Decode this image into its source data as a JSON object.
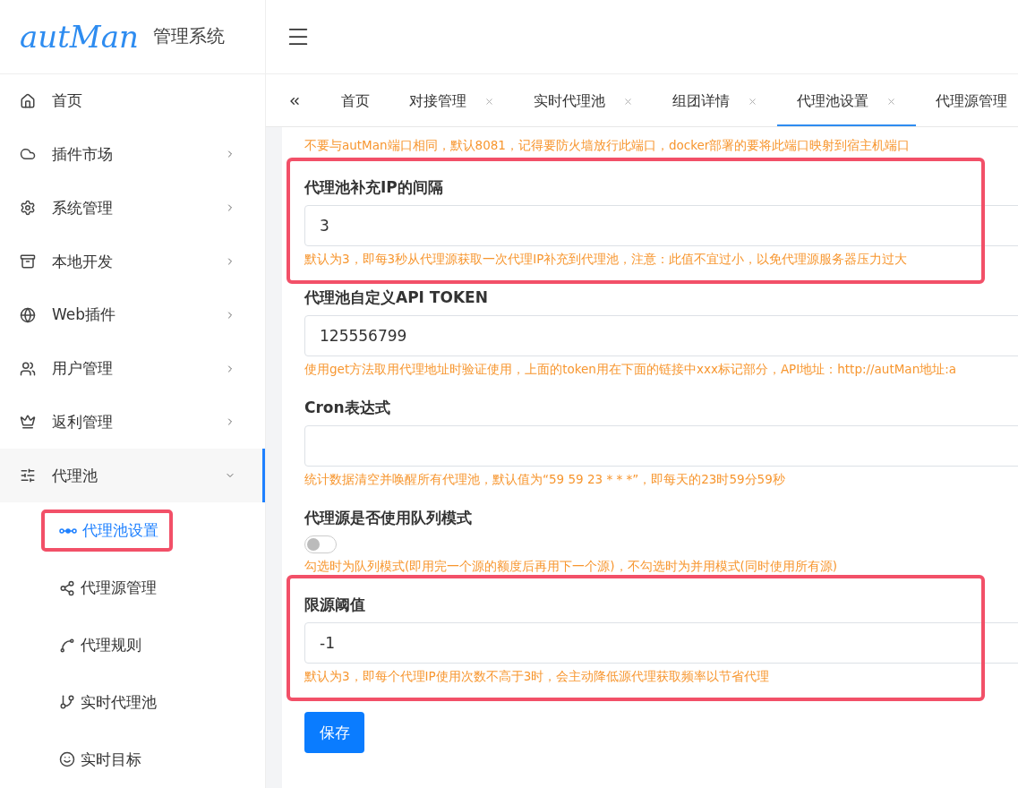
{
  "brand": {
    "logo": "autMan",
    "title": "管理系统"
  },
  "sidebar": {
    "items": [
      {
        "label": "首页",
        "has_submenu": false,
        "expanded": false
      },
      {
        "label": "插件市场",
        "has_submenu": true,
        "expanded": false
      },
      {
        "label": "系统管理",
        "has_submenu": true,
        "expanded": false
      },
      {
        "label": "本地开发",
        "has_submenu": true,
        "expanded": false
      },
      {
        "label": "Web插件",
        "has_submenu": true,
        "expanded": false
      },
      {
        "label": "用户管理",
        "has_submenu": true,
        "expanded": false
      },
      {
        "label": "返利管理",
        "has_submenu": true,
        "expanded": false
      },
      {
        "label": "代理池",
        "has_submenu": true,
        "expanded": true,
        "children": [
          {
            "label": "代理池设置",
            "selected": true,
            "highlighted": true
          },
          {
            "label": "代理源管理",
            "selected": false,
            "highlighted": false
          },
          {
            "label": "代理规则",
            "selected": false,
            "highlighted": false
          },
          {
            "label": "实时代理池",
            "selected": false,
            "highlighted": false
          },
          {
            "label": "实时目标",
            "selected": false,
            "highlighted": false
          }
        ]
      }
    ]
  },
  "tabs": [
    {
      "label": "首页",
      "closable": false,
      "selected": false
    },
    {
      "label": "对接管理",
      "closable": true,
      "selected": false
    },
    {
      "label": "实时代理池",
      "closable": true,
      "selected": false
    },
    {
      "label": "组团详情",
      "closable": true,
      "selected": false
    },
    {
      "label": "代理池设置",
      "closable": true,
      "selected": true
    },
    {
      "label": "代理源管理",
      "closable": false,
      "selected": false
    }
  ],
  "form": {
    "top_hint": "不要与autMan端口相同，默认8081，记得要防火墙放行此端口，docker部署的要将此端口映射到宿主机端口",
    "fields": [
      {
        "kind": "input",
        "label": "代理池补充IP的间隔",
        "value": "3",
        "hint": "默认为3，即每3秒从代理源获取一次代理IP补充到代理池，注意：此值不宜过小，以免代理源服务器压力过大",
        "highlighted": true
      },
      {
        "kind": "input",
        "label": "代理池自定义API TOKEN",
        "value": "125556799",
        "hint": "使用get方法取用代理地址时验证使用，上面的token用在下面的链接中xxx标记部分，API地址：http://autMan地址:a",
        "highlighted": false
      },
      {
        "kind": "input",
        "label": "Cron表达式",
        "hint": "统计数据清空并唤醒所有代理池，默认值为“59 59 23 * * *”，即每天的23时59分59秒",
        "highlighted": false
      },
      {
        "kind": "toggle",
        "label": "代理源是否使用队列模式",
        "on": false,
        "hint": "勾选时为队列模式(即用完一个源的额度后再用下一个源)，不勾选时为并用模式(同时使用所有源)",
        "highlighted": false
      },
      {
        "kind": "input",
        "label": "限源阈值",
        "value": "-1",
        "hint": "默认为3，即每个代理IP使用次数不高于3时，会主动降低源代理获取频率以节省代理",
        "highlighted": true
      }
    ],
    "save_button": "保存"
  }
}
